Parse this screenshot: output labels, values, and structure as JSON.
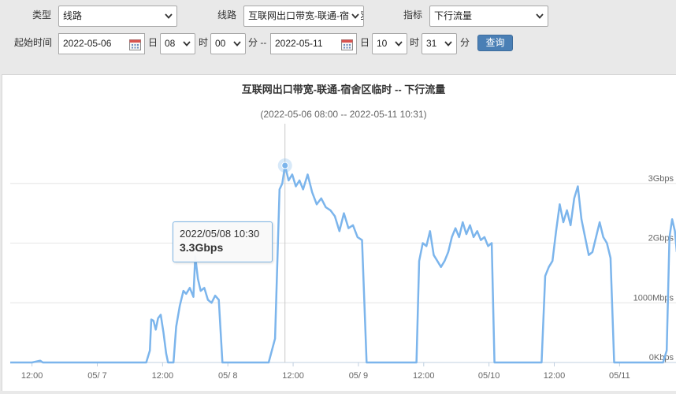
{
  "filters": {
    "type_label": "类型",
    "type_value": "线路",
    "line_label": "线路",
    "line_value": "互联网出口带宽-联通-宿舍区临时",
    "metric_label": "指标",
    "metric_value": "下行流量",
    "start_label": "起始时间",
    "start_date": "2022-05-06",
    "day_unit": "日",
    "start_hour": "08",
    "hour_unit": "时",
    "start_minute": "00",
    "minute_unit_dash": "分 --",
    "end_date": "2022-05-11",
    "end_day_unit": "日",
    "end_hour": "10",
    "end_hour_unit": "时",
    "end_minute": "31",
    "end_minute_unit": "分",
    "query_label": "查询"
  },
  "tooltip": {
    "time": "2022/05/08 10:30",
    "value": "3.3Gbps"
  },
  "colors": {
    "series": "#7cb5ec",
    "button": "#4a7fb5",
    "grid": "#e6e6e6"
  },
  "chart_data": {
    "type": "line",
    "title": "互联网出口带宽-联通-宿舍区临时 -- 下行流量",
    "subtitle": "(2022-05-06 08:00 -- 2022-05-11 10:31)",
    "x_range": [
      "2022-05-06 08:00",
      "2022-05-11 10:31"
    ],
    "x_ticks": [
      {
        "t": "2022-05-06 12:00",
        "label": "12:00"
      },
      {
        "t": "2022-05-07 00:00",
        "label": "05/ 7"
      },
      {
        "t": "2022-05-07 12:00",
        "label": "12:00"
      },
      {
        "t": "2022-05-08 00:00",
        "label": "05/ 8"
      },
      {
        "t": "2022-05-08 12:00",
        "label": "12:00"
      },
      {
        "t": "2022-05-09 00:00",
        "label": "05/ 9"
      },
      {
        "t": "2022-05-09 12:00",
        "label": "12:00"
      },
      {
        "t": "2022-05-10 00:00",
        "label": "05/10"
      },
      {
        "t": "2022-05-10 12:00",
        "label": "12:00"
      },
      {
        "t": "2022-05-11 00:00",
        "label": "05/11"
      }
    ],
    "y_unit": "Gbps",
    "ylim": [
      0,
      4
    ],
    "y_ticks": [
      {
        "v": 0,
        "label": "0Kbps"
      },
      {
        "v": 1,
        "label": "1000Mbps"
      },
      {
        "v": 2,
        "label": "2Gbps"
      },
      {
        "v": 3,
        "label": "3Gbps"
      }
    ],
    "grid": true,
    "crosshair_at": "2022-05-08 10:30",
    "series": [
      {
        "points": [
          [
            "2022-05-06 08:00",
            0.0
          ],
          [
            "2022-05-06 12:00",
            0.0
          ],
          [
            "2022-05-06 13:30",
            0.03
          ],
          [
            "2022-05-06 14:00",
            0.0
          ],
          [
            "2022-05-07 00:00",
            0.0
          ],
          [
            "2022-05-07 09:00",
            0.0
          ],
          [
            "2022-05-07 09:40",
            0.2
          ],
          [
            "2022-05-07 09:55",
            0.72
          ],
          [
            "2022-05-07 10:20",
            0.7
          ],
          [
            "2022-05-07 10:45",
            0.55
          ],
          [
            "2022-05-07 11:10",
            0.74
          ],
          [
            "2022-05-07 11:40",
            0.8
          ],
          [
            "2022-05-07 12:10",
            0.5
          ],
          [
            "2022-05-07 12:40",
            0.15
          ],
          [
            "2022-05-07 13:00",
            0.0
          ],
          [
            "2022-05-07 14:00",
            0.0
          ],
          [
            "2022-05-07 14:30",
            0.6
          ],
          [
            "2022-05-07 15:10",
            0.95
          ],
          [
            "2022-05-07 15:50",
            1.2
          ],
          [
            "2022-05-07 16:20",
            1.15
          ],
          [
            "2022-05-07 17:00",
            1.25
          ],
          [
            "2022-05-07 17:40",
            1.1
          ],
          [
            "2022-05-07 18:00",
            1.78
          ],
          [
            "2022-05-07 18:30",
            1.4
          ],
          [
            "2022-05-07 19:00",
            1.2
          ],
          [
            "2022-05-07 19:40",
            1.25
          ],
          [
            "2022-05-07 20:20",
            1.05
          ],
          [
            "2022-05-07 21:00",
            1.0
          ],
          [
            "2022-05-07 21:40",
            1.12
          ],
          [
            "2022-05-07 22:20",
            1.05
          ],
          [
            "2022-05-07 23:00",
            0.0
          ],
          [
            "2022-05-08 07:30",
            0.0
          ],
          [
            "2022-05-08 08:40",
            0.4
          ],
          [
            "2022-05-08 09:30",
            2.9
          ],
          [
            "2022-05-08 10:00",
            3.0
          ],
          [
            "2022-05-08 10:30",
            3.3
          ],
          [
            "2022-05-08 11:10",
            3.05
          ],
          [
            "2022-05-08 11:50",
            3.15
          ],
          [
            "2022-05-08 12:30",
            2.95
          ],
          [
            "2022-05-08 13:10",
            3.05
          ],
          [
            "2022-05-08 13:50",
            2.9
          ],
          [
            "2022-05-08 14:40",
            3.15
          ],
          [
            "2022-05-08 15:30",
            2.85
          ],
          [
            "2022-05-08 16:20",
            2.65
          ],
          [
            "2022-05-08 17:10",
            2.75
          ],
          [
            "2022-05-08 18:00",
            2.6
          ],
          [
            "2022-05-08 18:50",
            2.55
          ],
          [
            "2022-05-08 19:40",
            2.45
          ],
          [
            "2022-05-08 20:30",
            2.2
          ],
          [
            "2022-05-08 21:20",
            2.5
          ],
          [
            "2022-05-08 22:10",
            2.25
          ],
          [
            "2022-05-08 23:00",
            2.3
          ],
          [
            "2022-05-08 23:50",
            2.1
          ],
          [
            "2022-05-09 00:40",
            2.05
          ],
          [
            "2022-05-09 01:30",
            0.0
          ],
          [
            "2022-05-09 10:40",
            0.0
          ],
          [
            "2022-05-09 11:10",
            1.7
          ],
          [
            "2022-05-09 11:50",
            2.0
          ],
          [
            "2022-05-09 12:30",
            1.95
          ],
          [
            "2022-05-09 13:10",
            2.2
          ],
          [
            "2022-05-09 13:50",
            1.8
          ],
          [
            "2022-05-09 14:30",
            1.7
          ],
          [
            "2022-05-09 15:10",
            1.6
          ],
          [
            "2022-05-09 15:50",
            1.7
          ],
          [
            "2022-05-09 16:30",
            1.85
          ],
          [
            "2022-05-09 17:10",
            2.1
          ],
          [
            "2022-05-09 17:50",
            2.25
          ],
          [
            "2022-05-09 18:30",
            2.1
          ],
          [
            "2022-05-09 19:10",
            2.35
          ],
          [
            "2022-05-09 19:50",
            2.15
          ],
          [
            "2022-05-09 20:30",
            2.3
          ],
          [
            "2022-05-09 21:10",
            2.1
          ],
          [
            "2022-05-09 21:50",
            2.2
          ],
          [
            "2022-05-09 22:30",
            2.05
          ],
          [
            "2022-05-09 23:10",
            2.1
          ],
          [
            "2022-05-09 23:50",
            1.95
          ],
          [
            "2022-05-10 00:30",
            2.0
          ],
          [
            "2022-05-10 01:00",
            0.0
          ],
          [
            "2022-05-10 09:40",
            0.0
          ],
          [
            "2022-05-10 10:20",
            1.45
          ],
          [
            "2022-05-10 11:00",
            1.6
          ],
          [
            "2022-05-10 11:40",
            1.7
          ],
          [
            "2022-05-10 12:20",
            2.2
          ],
          [
            "2022-05-10 13:00",
            2.65
          ],
          [
            "2022-05-10 13:40",
            2.35
          ],
          [
            "2022-05-10 14:20",
            2.55
          ],
          [
            "2022-05-10 15:00",
            2.3
          ],
          [
            "2022-05-10 15:40",
            2.75
          ],
          [
            "2022-05-10 16:20",
            2.95
          ],
          [
            "2022-05-10 17:00",
            2.4
          ],
          [
            "2022-05-10 17:40",
            2.1
          ],
          [
            "2022-05-10 18:20",
            1.8
          ],
          [
            "2022-05-10 19:00",
            1.85
          ],
          [
            "2022-05-10 19:40",
            2.1
          ],
          [
            "2022-05-10 20:20",
            2.35
          ],
          [
            "2022-05-10 21:00",
            2.1
          ],
          [
            "2022-05-10 21:40",
            2.0
          ],
          [
            "2022-05-10 22:20",
            1.75
          ],
          [
            "2022-05-10 23:00",
            0.0
          ],
          [
            "2022-05-11 08:00",
            0.0
          ],
          [
            "2022-05-11 08:40",
            0.2
          ],
          [
            "2022-05-11 09:10",
            2.1
          ],
          [
            "2022-05-11 09:40",
            2.4
          ],
          [
            "2022-05-11 10:10",
            2.2
          ],
          [
            "2022-05-11 10:31",
            1.85
          ]
        ]
      }
    ]
  }
}
